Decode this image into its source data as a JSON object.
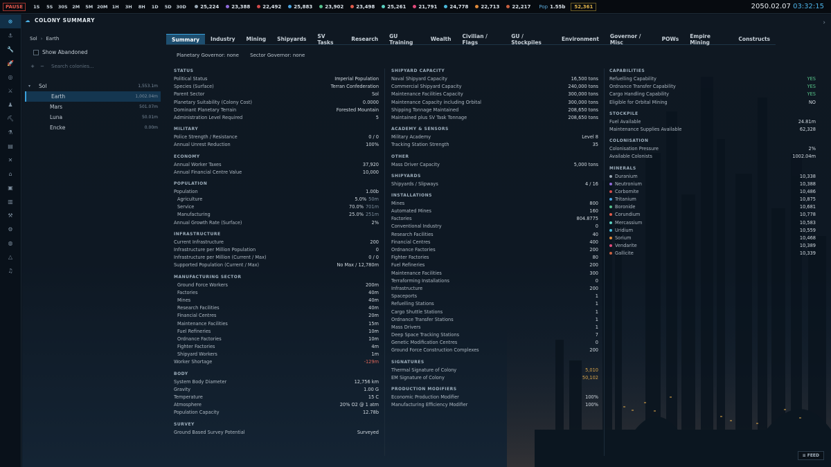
{
  "topbar": {
    "pause_label": "PAUSE",
    "time_steps": [
      "1S",
      "5S",
      "30S",
      "2M",
      "5M",
      "20M",
      "1H",
      "3H",
      "8H",
      "1D",
      "5D",
      "30D"
    ],
    "resources": [
      {
        "value": "25,224",
        "color": "#9aa7b3"
      },
      {
        "value": "23,388",
        "color": "#8f6ad8"
      },
      {
        "value": "22,492",
        "color": "#d24a4a"
      },
      {
        "value": "25,883",
        "color": "#4aa3e0"
      },
      {
        "value": "23,902",
        "color": "#55c08b"
      },
      {
        "value": "23,498",
        "color": "#e05a4a"
      },
      {
        "value": "25,261",
        "color": "#5bd0c0"
      },
      {
        "value": "21,791",
        "color": "#e04a7a"
      },
      {
        "value": "24,778",
        "color": "#4ab8d8"
      },
      {
        "value": "22,713",
        "color": "#e08a3a"
      },
      {
        "value": "22,217",
        "color": "#c86040"
      }
    ],
    "pop_label": "Pop",
    "pop_value": "1.55b",
    "wealth_value": "52,361",
    "date": "2050.02.07",
    "time": "03:32:15"
  },
  "sidebar_icons": [
    "galaxy-icon",
    "anchor-icon",
    "wrench-icon",
    "rocket-icon",
    "target-icon",
    "swords-icon",
    "person-icon",
    "pickaxe-icon",
    "flask-icon",
    "clipboard-icon",
    "crossed-icon",
    "tag-icon",
    "box-icon",
    "document-icon",
    "tools-icon",
    "gear-icon",
    "globe-icon",
    "alert-icon",
    "music-icon"
  ],
  "sidebar_glyphs": [
    "☸",
    "⚓",
    "🔧",
    "🚀",
    "◎",
    "⚔",
    "♟",
    "⛏",
    "⚗",
    "▤",
    "✕",
    "⌂",
    "▣",
    "▥",
    "⚒",
    "⚙",
    "◍",
    "△",
    "♫"
  ],
  "header": {
    "title": "COLONY SUMMARY",
    "icon": "☁",
    "close": "›"
  },
  "breadcrumb": {
    "system": "Sol",
    "sep": "›",
    "planet": "Earth"
  },
  "show_abandoned": "Show Abandoned",
  "search": {
    "placeholder": "Search colonies...",
    "plus": "+",
    "minus": "−"
  },
  "colonies": [
    {
      "name": "Sol",
      "pop": "1,553.1m",
      "caret": "▾"
    },
    {
      "name": "Earth",
      "pop": "1,002.04m"
    },
    {
      "name": "Mars",
      "pop": "501.07m"
    },
    {
      "name": "Luna",
      "pop": "50.01m"
    },
    {
      "name": "Encke",
      "pop": "0.00m"
    }
  ],
  "tabs": [
    "Summary",
    "Industry",
    "Mining",
    "Shipyards",
    "SV Tasks",
    "Research",
    "GU Training",
    "Wealth",
    "Civilian / Flags",
    "GU / Stockpiles",
    "Environment",
    "Governor / Misc",
    "POWs",
    "Empire Mining",
    "Constructs"
  ],
  "governors": {
    "planetary": "Planetary Governor: none",
    "sector": "Sector Governor: none"
  },
  "col1": [
    {
      "title": "STATUS",
      "rows": [
        {
          "k": "Political Status",
          "v": "Imperial Population"
        },
        {
          "k": "Species (Surface)",
          "v": "Terran Confederation"
        },
        {
          "k": "Parent Sector",
          "v": "Sol"
        },
        {
          "k": "Planetary Suitability (Colony Cost)",
          "v": "0.0000"
        },
        {
          "k": "Dominant Planetary Terrain",
          "v": "Forested Mountain"
        },
        {
          "k": "Administration Level Required",
          "v": "5"
        }
      ]
    },
    {
      "title": "MILITARY",
      "rows": [
        {
          "k": "Police Strength / Resistance",
          "v": "0 / 0"
        },
        {
          "k": "Annual Unrest Reduction",
          "v": "100%"
        }
      ]
    },
    {
      "title": "ECONOMY",
      "rows": [
        {
          "k": "Annual Worker Taxes",
          "v": "37,920"
        },
        {
          "k": "Annual Financial Centre Value",
          "v": "10,000"
        }
      ]
    },
    {
      "title": "POPULATION",
      "rows": [
        {
          "k": "Population",
          "v": "1.00b"
        },
        {
          "k": "Agriculture",
          "v": "5.0%",
          "p": "50m",
          "i": true
        },
        {
          "k": "Service",
          "v": "70.0%",
          "p": "701m",
          "i": true
        },
        {
          "k": "Manufacturing",
          "v": "25.0%",
          "p": "251m",
          "i": true
        },
        {
          "k": "Annual Growth Rate (Surface)",
          "v": "2%"
        }
      ]
    },
    {
      "title": "INFRASTRUCTURE",
      "rows": [
        {
          "k": "Current Infrastructure",
          "v": "200"
        },
        {
          "k": "Infrastructure per Million Population",
          "v": "0"
        },
        {
          "k": "Infrastructure per Million (Current / Max)",
          "v": "0 / 0"
        },
        {
          "k": "Supported Population (Current / Max)",
          "v": "No Max / 12,780m"
        }
      ]
    },
    {
      "title": "MANUFACTURING SECTOR",
      "rows": [
        {
          "k": "Ground Force Workers",
          "v": "200m",
          "i": true
        },
        {
          "k": "Factories",
          "v": "40m",
          "i": true
        },
        {
          "k": "Mines",
          "v": "40m",
          "i": true
        },
        {
          "k": "Research Facilities",
          "v": "40m",
          "i": true
        },
        {
          "k": "Financial Centres",
          "v": "20m",
          "i": true
        },
        {
          "k": "Maintenance Facilities",
          "v": "15m",
          "i": true
        },
        {
          "k": "Fuel Refineries",
          "v": "10m",
          "i": true
        },
        {
          "k": "Ordnance Factories",
          "v": "10m",
          "i": true
        },
        {
          "k": "Fighter Factories",
          "v": "4m",
          "i": true
        },
        {
          "k": "Shipyard Workers",
          "v": "1m",
          "i": true
        },
        {
          "k": "Worker Shortage",
          "v": "-129m",
          "c": "#e0675a"
        }
      ]
    },
    {
      "title": "BODY",
      "rows": [
        {
          "k": "System Body Diameter",
          "v": "12,756 km"
        },
        {
          "k": "Gravity",
          "v": "1.00 G"
        },
        {
          "k": "Temperature",
          "v": "15 C"
        },
        {
          "k": "Atmosphere",
          "v": "20% O2 @ 1 atm"
        },
        {
          "k": "Population Capacity",
          "v": "12.78b"
        }
      ]
    },
    {
      "title": "SURVEY",
      "rows": [
        {
          "k": "Ground Based Survey Potential",
          "v": "Surveyed"
        }
      ]
    }
  ],
  "col2": [
    {
      "title": "SHIPYARD CAPACITY",
      "rows": [
        {
          "k": "Naval Shipyard Capacity",
          "v": "16,500 tons"
        },
        {
          "k": "Commercial Shipyard Capacity",
          "v": "240,000 tons"
        },
        {
          "k": "Maintenance Facilities Capacity",
          "v": "300,000 tons"
        },
        {
          "k": "Maintenance Capacity including Orbital",
          "v": "300,000 tons"
        },
        {
          "k": "Shipping Tonnage Maintained",
          "v": "208,650 tons"
        },
        {
          "k": "Maintained plus SV Task Tonnage",
          "v": "208,650 tons"
        }
      ]
    },
    {
      "title": "ACADEMY & SENSORS",
      "rows": [
        {
          "k": "Military Academy",
          "v": "Level 8"
        },
        {
          "k": "Tracking Station Strength",
          "v": "35"
        }
      ]
    },
    {
      "title": "OTHER",
      "rows": [
        {
          "k": "Mass Driver Capacity",
          "v": "5,000 tons"
        }
      ]
    },
    {
      "title": "SHIPYARDS",
      "rows": [
        {
          "k": "Shipyards / Slipways",
          "v": "4 / 16"
        }
      ]
    },
    {
      "title": "INSTALLATIONS",
      "rows": [
        {
          "k": "Mines",
          "v": "800"
        },
        {
          "k": "Automated Mines",
          "v": "160"
        },
        {
          "k": "Factories",
          "v": "804.8775"
        },
        {
          "k": "Conventional Industry",
          "v": "0"
        },
        {
          "k": "Research Facilities",
          "v": "40"
        },
        {
          "k": "Financial Centres",
          "v": "400"
        },
        {
          "k": "Ordnance Factories",
          "v": "200"
        },
        {
          "k": "Fighter Factories",
          "v": "80"
        },
        {
          "k": "Fuel Refineries",
          "v": "200"
        },
        {
          "k": "Maintenance Facilities",
          "v": "300"
        },
        {
          "k": "Terraforming Installations",
          "v": "0"
        },
        {
          "k": "Infrastructure",
          "v": "200"
        },
        {
          "k": "Spaceports",
          "v": "1"
        },
        {
          "k": "Refuelling Stations",
          "v": "1"
        },
        {
          "k": "Cargo Shuttle Stations",
          "v": "1"
        },
        {
          "k": "Ordnance Transfer Stations",
          "v": "1"
        },
        {
          "k": "Mass Drivers",
          "v": "1"
        },
        {
          "k": "Deep Space Tracking Stations",
          "v": "7"
        },
        {
          "k": "Genetic Modification Centres",
          "v": "0"
        },
        {
          "k": "Ground Force Construction Complexes",
          "v": "200"
        }
      ]
    },
    {
      "title": "SIGNATURES",
      "rows": [
        {
          "k": "Thermal Signature of Colony",
          "v": "5,010",
          "c": "#d9a54a"
        },
        {
          "k": "EM Signature of Colony",
          "v": "50,102",
          "c": "#d9a54a"
        }
      ]
    },
    {
      "title": "PRODUCTION MODIFIERS",
      "rows": [
        {
          "k": "Economic Production Modifier",
          "v": "100%"
        },
        {
          "k": "Manufacturing Efficiency Modifier",
          "v": "100%"
        }
      ]
    }
  ],
  "col3": [
    {
      "title": "CAPABILITIES",
      "rows": [
        {
          "k": "Refuelling Capability",
          "v": "YES",
          "c": "#58c48a"
        },
        {
          "k": "Ordnance Transfer Capability",
          "v": "YES",
          "c": "#58c48a"
        },
        {
          "k": "Cargo Handling Capability",
          "v": "YES",
          "c": "#58c48a"
        },
        {
          "k": "Eligible for Orbital Mining",
          "v": "NO"
        }
      ]
    },
    {
      "title": "STOCKPILE",
      "rows": [
        {
          "k": "Fuel Available",
          "v": "24.81m"
        },
        {
          "k": "Maintenance Supplies Available",
          "v": "62,328"
        }
      ]
    },
    {
      "title": "COLONISATION",
      "rows": [
        {
          "k": "Colonisation Pressure",
          "v": "2%"
        },
        {
          "k": "Available Colonists",
          "v": "1002.04m"
        }
      ]
    },
    {
      "title": "MINERALS",
      "rows": [
        {
          "k": "Duranium",
          "v": "10,338",
          "d": "#9aa7b3"
        },
        {
          "k": "Neutronium",
          "v": "10,388",
          "d": "#8f6ad8"
        },
        {
          "k": "Corbomite",
          "v": "10,486",
          "d": "#d24a4a"
        },
        {
          "k": "Tritanium",
          "v": "10,875",
          "d": "#4aa3e0"
        },
        {
          "k": "Boronide",
          "v": "10,681",
          "d": "#55c08b"
        },
        {
          "k": "Corundium",
          "v": "10,778",
          "d": "#e05a4a"
        },
        {
          "k": "Mercassium",
          "v": "10,583",
          "d": "#5bd0c0"
        },
        {
          "k": "Uridium",
          "v": "10,559",
          "d": "#4ab8d8"
        },
        {
          "k": "Sorium",
          "v": "10,468",
          "d": "#e08a3a"
        },
        {
          "k": "Vendarite",
          "v": "10,389",
          "d": "#e04a7a"
        },
        {
          "k": "Gallicite",
          "v": "10,339",
          "d": "#c86040"
        }
      ]
    }
  ],
  "feed_label": "FEED"
}
